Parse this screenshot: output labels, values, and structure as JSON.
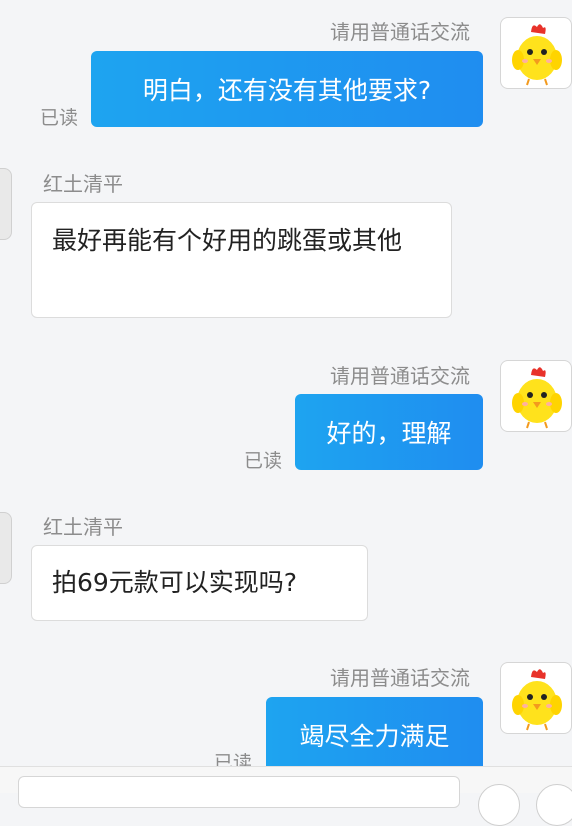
{
  "messages": [
    {
      "id": 1,
      "dir": "out",
      "sender": "请用普通话交流",
      "text": "明白，还有没有其他要求?",
      "read": "已读"
    },
    {
      "id": 2,
      "dir": "in",
      "sender": "红土清平",
      "text": "最好再能有个好用的跳蛋或其他"
    },
    {
      "id": 3,
      "dir": "out",
      "sender": "请用普通话交流",
      "text": "好的，理解",
      "read": "已读"
    },
    {
      "id": 4,
      "dir": "in",
      "sender": "红土清平",
      "text": "拍69元款可以实现吗?"
    },
    {
      "id": 5,
      "dir": "out",
      "sender": "请用普通话交流",
      "text": "竭尽全力满足",
      "read": "已读"
    }
  ],
  "avatar": {
    "icon": "chick-avatar-icon",
    "body_color": "#ffe21c",
    "comb_color": "#e8322a",
    "beak_color": "#f39a1e"
  },
  "colors": {
    "bubble_out": "#1f96f0",
    "background": "#f4f5f7"
  }
}
